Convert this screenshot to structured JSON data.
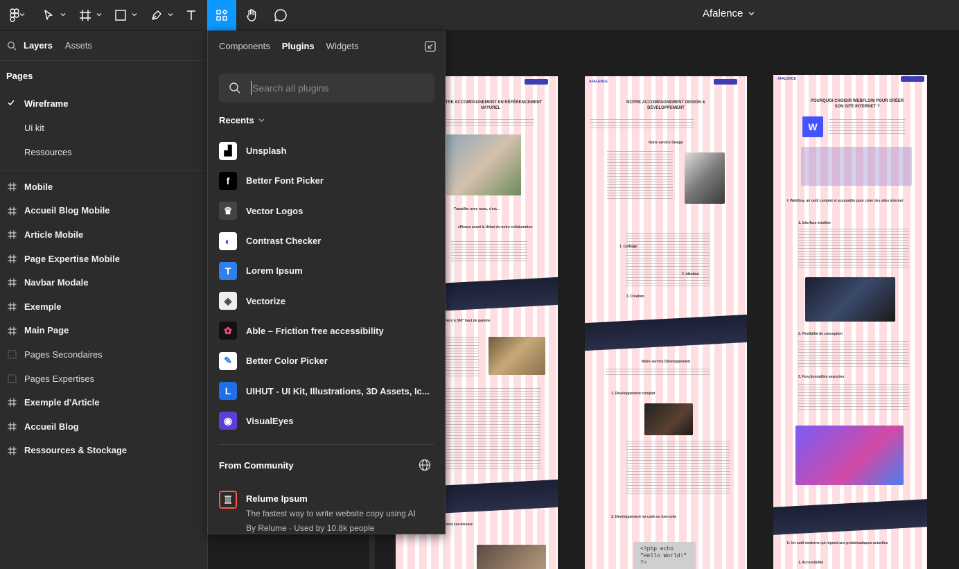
{
  "toolbar": {
    "document_title": "Afalence",
    "tools": [
      "main-menu",
      "move",
      "frame",
      "shape",
      "pen",
      "text",
      "resources",
      "hand",
      "comment"
    ],
    "active_tool": "resources",
    "accent": "#0d99ff"
  },
  "left_panel": {
    "tabs": {
      "layers": "Layers",
      "assets": "Assets"
    },
    "pages_heading": "Pages",
    "pages": [
      {
        "label": "Wireframe",
        "selected": true
      },
      {
        "label": "Ui kit",
        "selected": false
      },
      {
        "label": "Ressources",
        "selected": false
      }
    ],
    "frames": [
      {
        "label": "Mobile",
        "icon": "frame-icon"
      },
      {
        "label": "Accueil Blog Mobile",
        "icon": "frame-icon"
      },
      {
        "label": "Article Mobile",
        "icon": "frame-icon"
      },
      {
        "label": "Page Expertise Mobile",
        "icon": "frame-icon"
      },
      {
        "label": "Navbar Modale",
        "icon": "frame-icon"
      },
      {
        "label": "Exemple",
        "icon": "frame-icon"
      },
      {
        "label": "Main Page",
        "icon": "frame-icon"
      },
      {
        "label": "Pages Secondaires",
        "icon": "section-icon"
      },
      {
        "label": "Pages Expertises",
        "icon": "section-icon"
      },
      {
        "label": "Exemple d'Article",
        "icon": "frame-icon"
      },
      {
        "label": "Accueil Blog",
        "icon": "frame-icon"
      },
      {
        "label": "Ressources & Stockage",
        "icon": "frame-icon"
      }
    ]
  },
  "plugin_panel": {
    "tabs": {
      "components": "Components",
      "plugins": "Plugins",
      "widgets": "Widgets"
    },
    "search_placeholder": "Search all plugins",
    "recents_label": "Recents",
    "recents": [
      {
        "name": "Unsplash",
        "icon": "unsplash-icon",
        "bg": "#ffffff",
        "fg": "#000000",
        "glyph": "▟"
      },
      {
        "name": "Better Font Picker",
        "icon": "font-picker-icon",
        "bg": "#000000",
        "fg": "#ffffff",
        "glyph": "f"
      },
      {
        "name": "Vector Logos",
        "icon": "vector-logos-icon",
        "bg": "#444444",
        "fg": "#ffffff",
        "glyph": "♛"
      },
      {
        "name": "Contrast Checker",
        "icon": "contrast-checker-icon",
        "bg": "#ffffff",
        "fg": "#6a2bd9",
        "glyph": "◐"
      },
      {
        "name": "Lorem Ipsum",
        "icon": "lorem-ipsum-icon",
        "bg": "#2f80ed",
        "fg": "#ffffff",
        "glyph": "T"
      },
      {
        "name": "Vectorize",
        "icon": "vectorize-icon",
        "bg": "#eeeeee",
        "fg": "#444444",
        "glyph": "◈"
      },
      {
        "name": "Able – Friction free accessibility",
        "icon": "able-icon",
        "bg": "#111111",
        "fg": "#ff4d7a",
        "glyph": "✿"
      },
      {
        "name": "Better Color Picker",
        "icon": "color-picker-icon",
        "bg": "#ffffff",
        "fg": "#2f80ed",
        "glyph": "✎"
      },
      {
        "name": "UIHUT - UI Kit, Illustrations, 3D Assets, Ic...",
        "icon": "uihut-icon",
        "bg": "#1e6fe8",
        "fg": "#ffffff",
        "glyph": "L"
      },
      {
        "name": "VisualEyes",
        "icon": "visualeyes-icon",
        "bg": "#5b3fd6",
        "fg": "#ffffff",
        "glyph": "◉"
      }
    ],
    "community_label": "From Community",
    "community": [
      {
        "name": "Relume Ipsum",
        "description": "The fastest way to write website copy using AI",
        "byline": "By Relume · Used by 10.8k people",
        "icon": "relume-icon"
      }
    ]
  },
  "canvas": {
    "artboards": [
      {
        "title": "NOTRE ACCOMPAGNEMENT EN RÉFÉRENCEMENT NATUREL",
        "nav": [
          "Expertise",
          "Relume",
          "Cases",
          "Article"
        ],
        "nav_button": "Nous Contacter",
        "headings": [
          "Travailler avec nous, c'est...",
          "efficace avant le début de notre collaboration",
          "accompagnement à 360° haut de gamme",
          "accompagnement sur-mesure"
        ]
      },
      {
        "brand": "AFALENCE",
        "title": "NOTRE ACCOMPAGNEMENT DESIGN & DÉVELOPPEMENT",
        "nav": [
          "Expertise",
          "Relume",
          "Cases",
          "Article"
        ],
        "nav_button": "Nous Contacter",
        "headings": [
          "Notre service Design",
          "1. Cadrage",
          "2. Idéation",
          "3. Création",
          "Notre service Développement",
          "1. Développement complet",
          "2. Développement no-code ou low-code"
        ],
        "code_snippet": "<?php echo \"Hello World!\" ?>"
      },
      {
        "brand": "AFALENCE",
        "title": "POURQUOI CHOISIR WEBFLOW POUR CRÉER SON SITE INTERNET ?",
        "nav": [
          "Expertise",
          "Relume",
          "Cases",
          "Article"
        ],
        "nav_button": "Nous Contacter",
        "headings": [
          "I. Webflow, un outil complet et accessible pour créer des sites internet",
          "1. Interface intuitive",
          "2. Flexibilité de conception",
          "3. Fonctionnalités avancées",
          "II. Un outil moderne qui répond aux problématiques actuelles",
          "1. Accessibilité"
        ]
      }
    ]
  }
}
